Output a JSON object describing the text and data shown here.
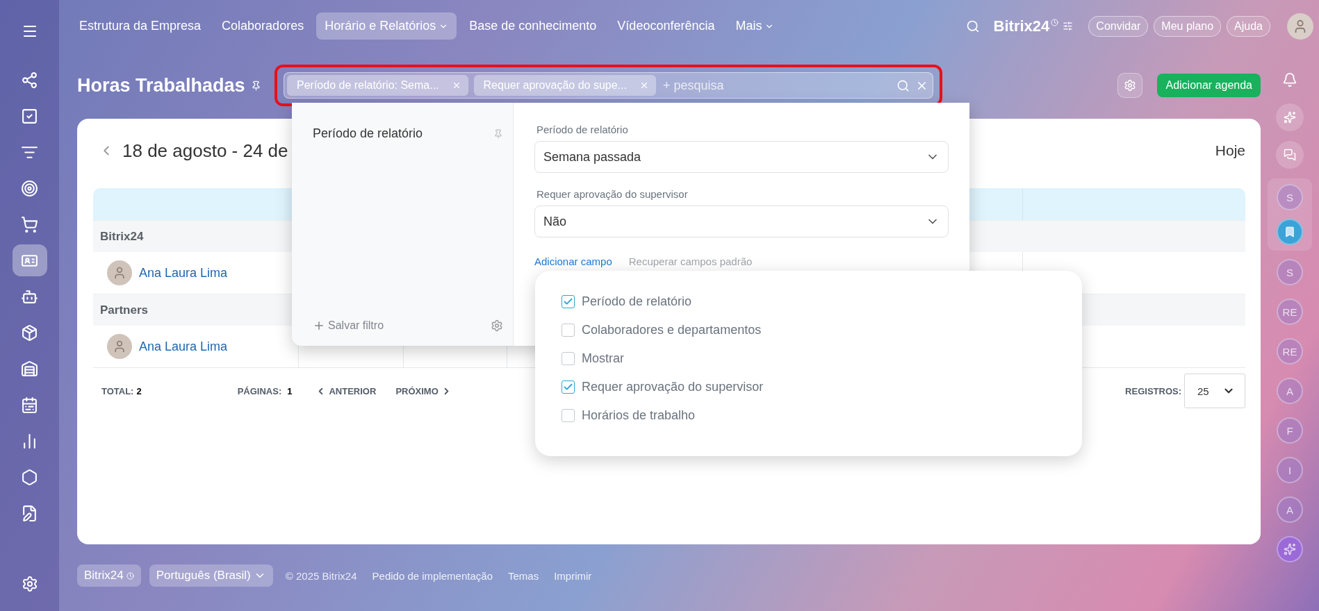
{
  "top_nav": {
    "items": [
      {
        "label": "Estrutura da Empresa",
        "selected": false,
        "has_menu": false
      },
      {
        "label": "Colaboradores",
        "selected": false,
        "has_menu": false
      },
      {
        "label": "Horário e Relatórios",
        "selected": true,
        "has_menu": true
      },
      {
        "label": "Base de conhecimento",
        "selected": false,
        "has_menu": false
      },
      {
        "label": "Vídeoconferência",
        "selected": false,
        "has_menu": false
      },
      {
        "label": "Mais",
        "selected": false,
        "has_menu": true
      }
    ],
    "brand": "Bitrix24",
    "buttons": [
      "Convidar",
      "Meu plano",
      "Ajuda"
    ]
  },
  "sidebar": {
    "items": [
      {
        "selected": false
      },
      {
        "selected": false
      },
      {
        "selected": false
      },
      {
        "selected": false
      },
      {
        "selected": false
      },
      {
        "selected": true
      },
      {
        "selected": false
      },
      {
        "selected": false
      },
      {
        "selected": false
      },
      {
        "selected": false
      },
      {
        "selected": false
      },
      {
        "selected": false
      },
      {
        "selected": false
      }
    ]
  },
  "header": {
    "title": "Horas Trabalhadas",
    "add_button": "Adicionar agenda"
  },
  "search": {
    "highlighted": true,
    "chips": [
      {
        "label": "Período de relatório: Sema..."
      },
      {
        "label": "Requer aprovação do supe..."
      }
    ],
    "placeholder": "+ pesquisa"
  },
  "report": {
    "period": "18 de agosto - 24 de",
    "today": "Hoje",
    "groups": [
      {
        "name": "Bitrix24",
        "members": [
          {
            "name": "Ana Laura Lima"
          }
        ]
      },
      {
        "name": "Partners",
        "members": [
          {
            "name": "Ana Laura Lima"
          }
        ]
      }
    ],
    "total_label": "TOTAL:",
    "total": "2",
    "pages_label": "PÁGINAS:",
    "pages": "1",
    "prev": "ANTERIOR",
    "next": "PRÓXIMO",
    "records_label": "REGISTROS:",
    "records": "25"
  },
  "filter_popup": {
    "presets": [
      {
        "label": "Período de relatório"
      }
    ],
    "save_filter": "Salvar filtro",
    "fields": [
      {
        "label": "Período de relatório",
        "value": "Semana passada"
      },
      {
        "label": "Requer aprovação do supervisor",
        "value": "Não"
      }
    ],
    "add_field": "Adicionar campo",
    "restore_fields": "Recuperar campos padrão"
  },
  "field_menu": {
    "items": [
      {
        "label": "Período de relatório",
        "checked": true
      },
      {
        "label": "Colaboradores e departamentos",
        "checked": false
      },
      {
        "label": "Mostrar",
        "checked": false
      },
      {
        "label": "Requer aprovação do supervisor",
        "checked": true
      },
      {
        "label": "Horários de trabalho",
        "checked": false
      }
    ]
  },
  "right_bar": {
    "pinned": [
      {
        "kind": "letter",
        "text": "S"
      },
      {
        "kind": "bookmark"
      }
    ],
    "chats": [
      {
        "text": "S"
      },
      {
        "text": "RE"
      },
      {
        "text": "RE"
      },
      {
        "text": "A"
      },
      {
        "text": "F"
      },
      {
        "text": "I"
      },
      {
        "text": "A"
      }
    ]
  },
  "footer": {
    "brand": "Bitrix24",
    "language": "Português (Brasil)",
    "copyright": "© 2025 Bitrix24",
    "links": [
      "Pedido de implementação",
      "Temas",
      "Imprimir"
    ]
  }
}
